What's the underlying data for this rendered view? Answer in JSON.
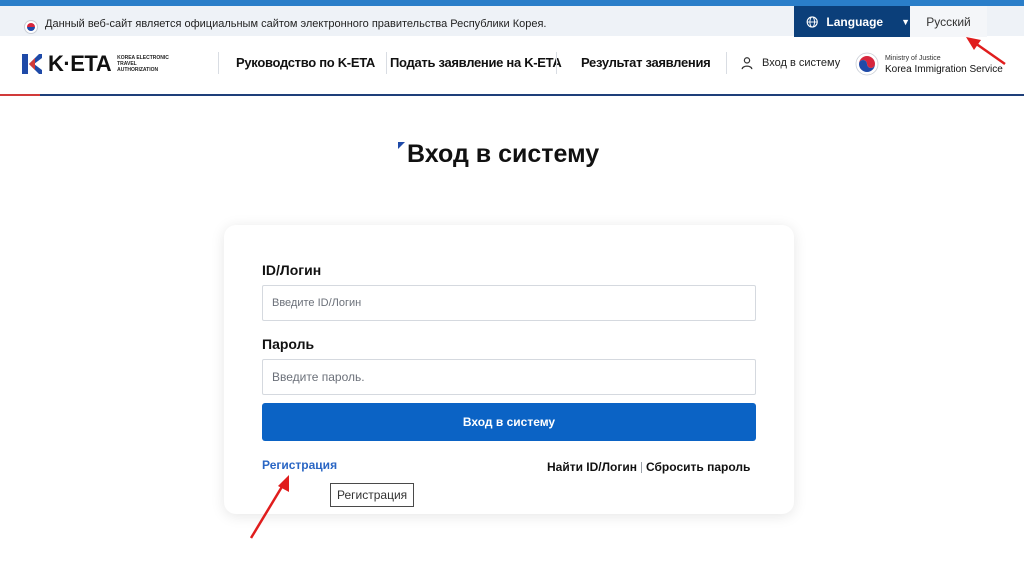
{
  "gov_banner": {
    "flag_icon": "korea-flag-icon",
    "text": "Данный веб-сайт является официальным сайтом электронного правительства Республики Корея."
  },
  "language": {
    "icon": "globe-icon",
    "button_label": "Language",
    "caret_icon": "caret-down-icon",
    "current": "Русский"
  },
  "header": {
    "logo": {
      "text": "K·ETA",
      "subtitle": "KOREA ELECTRONIC TRAVEL AUTHORIZATION"
    },
    "nav": [
      {
        "label": "Руководство по K-ETA"
      },
      {
        "label": "Подать заявление на K-ETA"
      },
      {
        "label": "Результат заявления"
      }
    ],
    "login_label": "Вход в систему",
    "login_icon": "user-icon",
    "ministry": {
      "line1": "Ministry of Justice",
      "line2": "Korea Immigration Service"
    }
  },
  "main": {
    "title": "Вход в систему",
    "form": {
      "id_label": "ID/Логин",
      "id_placeholder": "Введите ID/Логин",
      "password_label": "Пароль",
      "password_placeholder": "Введите пароль.",
      "submit_label": "Вход в систему",
      "register_label": "Регистрация",
      "find_id_label": "Найти ID/Логин",
      "reset_password_label": "Сбросить пароль",
      "tooltip": "Регистрация"
    }
  },
  "colors": {
    "brand_navy": "#0b3f7a",
    "primary_button": "#0b63c5",
    "link_blue": "#2a66c4",
    "annotation_red": "#e01d1d"
  }
}
